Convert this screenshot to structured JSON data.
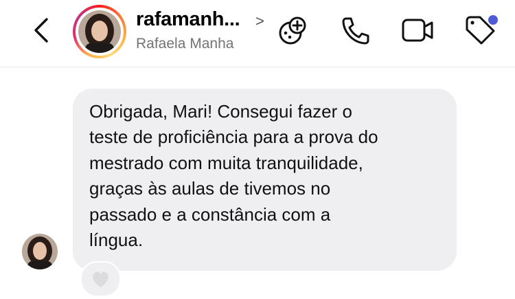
{
  "header": {
    "username": "rafamanh...",
    "chevron": ">",
    "real_name": "Rafaela Manha",
    "icons": [
      "back-chevron-icon",
      "games-icon",
      "phone-icon",
      "video-icon",
      "tag-icon"
    ],
    "notification_dot_color": "#4f5bd5"
  },
  "conversation": {
    "message_text": "Obrigada, Mari! Consegui fazer o\nteste de proficiência para a prova do\nmestrado com muita tranquilidade,\ngraças às aulas de tivemos no\npassado e a constância com a\nlíngua.",
    "bubble_color": "#efeff1",
    "reaction": "heart-icon"
  }
}
